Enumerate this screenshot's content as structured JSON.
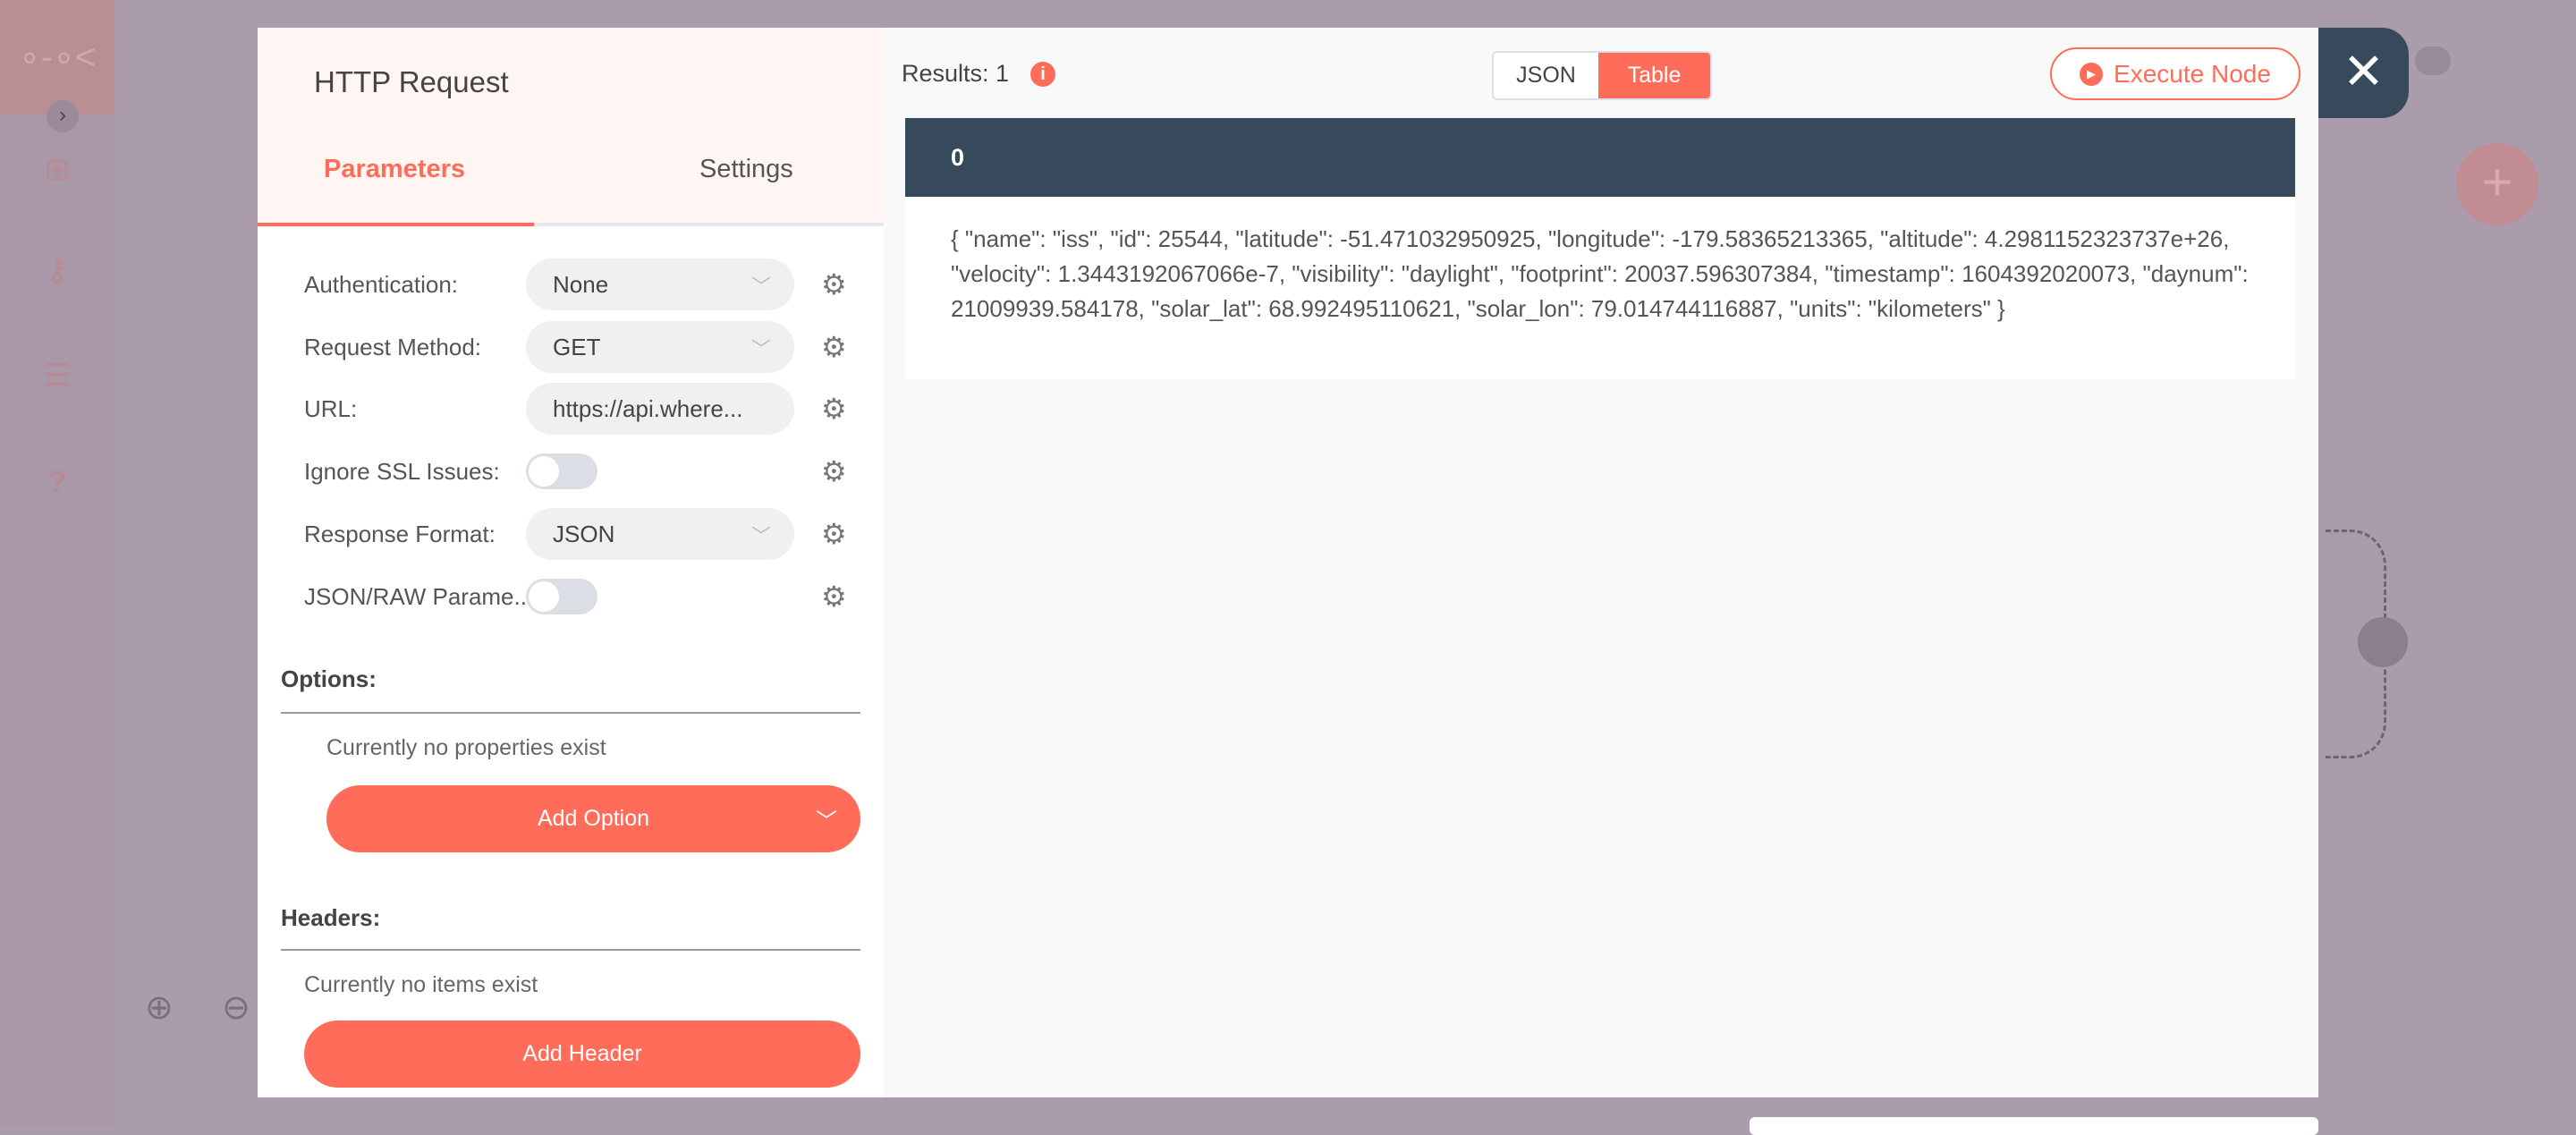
{
  "node": {
    "title": "HTTP Request",
    "tabs": [
      {
        "label": "Parameters",
        "active": true
      },
      {
        "label": "Settings",
        "active": false
      }
    ]
  },
  "parameters": [
    {
      "label": "Authentication:",
      "type": "select",
      "value": "None"
    },
    {
      "label": "Request Method:",
      "type": "select",
      "value": "GET"
    },
    {
      "label": "URL:",
      "type": "input",
      "value": "https://api.where..."
    },
    {
      "label": "Ignore SSL Issues:",
      "type": "toggle",
      "value": false
    },
    {
      "label": "Response Format:",
      "type": "select",
      "value": "JSON"
    },
    {
      "label": "JSON/RAW Parame...",
      "type": "toggle",
      "value": false
    }
  ],
  "options": {
    "title": "Options:",
    "empty": "Currently no properties exist",
    "button": "Add Option"
  },
  "headers": {
    "title": "Headers:",
    "empty": "Currently no items exist",
    "button": "Add Header"
  },
  "output": {
    "results": "Results: 1",
    "view_modes": [
      "JSON",
      "Table"
    ],
    "active_view": "Table",
    "execute": "Execute Node",
    "table": {
      "header": "0",
      "cell": "{ \"name\": \"iss\", \"id\": 25544, \"latitude\": -51.471032950925, \"longitude\": -179.58365213365, \"altitude\": 4.2981152323737e+26, \"velocity\": 1.3443192067066e-7, \"visibility\": \"daylight\", \"footprint\": 20037.596307384, \"timestamp\": 1604392020073, \"daynum\": 21009939.584178, \"solar_lat\": 68.992495110621, \"solar_lon\": 79.014744116887, \"units\": \"kilometers\" }"
    }
  },
  "colors": {
    "accent": "#ff6d5a",
    "dark": "#374a5b",
    "overlay": "#aa9cab"
  }
}
